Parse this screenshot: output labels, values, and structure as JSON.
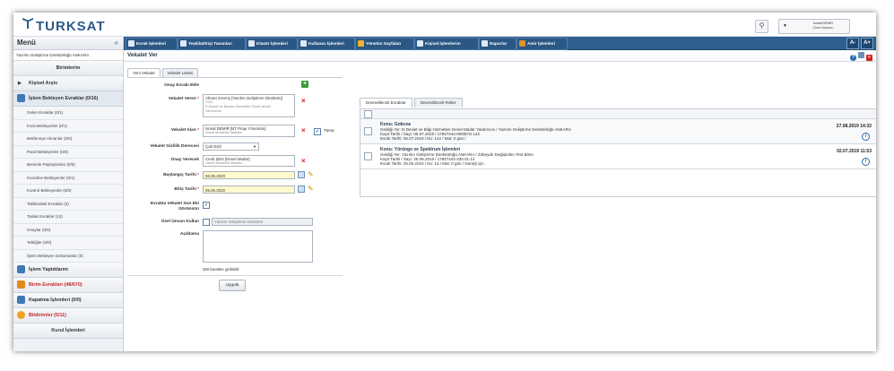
{
  "header": {
    "brand": "TURKSAT",
    "user_name": "İsmail DEMİR",
    "user_title": "(Daire Başkanı)"
  },
  "sidebar": {
    "title": "Menü",
    "unit": "Yazılım Geliştirme Direktörlüğü ANKARA",
    "sections": {
      "birimlerim": "Birimlerim",
      "kisisel_arsiv": "Kişisel Arşiv",
      "islem_bekleyen": "İşlem Bekleyen Evraklar (0/16)",
      "islem_yaptiklarim": "İşlem Yaptıklarım",
      "birim_evraklari": "Birim Evrakları (48/670)",
      "kapatma": "Kapatma İşlemleri (0/0)",
      "bildirimler": "Bildirimler (5/11)",
      "kurul": "Kurul İşlemleri"
    },
    "items": [
      "Gelen Evraklar (0/1)",
      "İmza Bekleyenler (0/1)",
      "Bekleneye Alınanlar (0/0)",
      "Paraf Bekleyenler (0/0)",
      "Benimle Paylaşılanlar (0/5)",
      "Koordine Bekleyenler (0/1)",
      "Kontrol Bekleyenler (0/0)",
      "Takibindeki Evraklar (0)",
      "Taslak Evraklar (13)",
      "Onaylar (0/0)",
      "Tebliğler (0/0)",
      "İşlem Bekleyen Dokümanlar (0)"
    ]
  },
  "toolbar": {
    "items": [
      "Evrak İşlemleri",
      "Teşkilat/Kişi Tanımları",
      "Klasör İşlemleri",
      "Kullanıcı İşlemleri",
      "Yönetim Sayfaları",
      "Kişisel İşlemlerim",
      "Raporlar",
      "Amir İşlemleri"
    ],
    "font_small": "A-",
    "font_large": "A+"
  },
  "page": {
    "title": "Vekalet Ver",
    "tabs": [
      "Yeni Vekalet",
      "Vekalet Listesi"
    ]
  },
  "form": {
    "onay_evraki_label": "Onay Evrakı Ekle",
    "vekalet_veren_label": "Vekalet Veren",
    "vekalet_veren_name": "Ahmet SAVAŞ [Yazılım Geliştirme Direktörü]",
    "vekalet_veren_l2": "YGD",
    "vekalet_veren_l3": "E-Devlet ve Birişim Hizmetleri Genel Müdür",
    "vekalet_veren_l4": "Yardımcısı",
    "vekalet_alan_label": "Vekalet Alan",
    "vekalet_alan_name": "İsmail DEMİR [BT Proje Yöneticisi]",
    "vekalet_alan_sub": "Genel Müdürlük Makamı",
    "tumu_label": "Tümü",
    "gizlilik_label": "Vekalet Gizlilik Derecesi",
    "gizlilik_value": "Çok Gizli",
    "onay_verecek_label": "Onay Verecek",
    "onay_verecek_name": "Cenk ŞEN [Genel Müdür]",
    "onay_verecek_sub": "Genel Müdürlük Makamı",
    "baslangic_label": "Başlangıç Tarihi",
    "baslangic_value": "06.05.2020",
    "bitis_label": "Bitiş Tarihi",
    "bitis_value": "06.05.2020",
    "son_eki_label_1": "Evrakta Vekalet Son Eki",
    "son_eki_label_2": "Görünsün",
    "ozel_unvan_label": "Özel Ünvan Kullan",
    "ozel_unvan_placeholder": "Yazılım Geliştirme Direktörü",
    "aciklama_label": "Açıklama",
    "char_count": "250 karakter girilebilir",
    "submit": "Uygula"
  },
  "right": {
    "tabs": [
      "Devredilecek Evraklar",
      "Devredilecek Roller"
    ],
    "items": [
      {
        "subject": "Konu: Gokcea",
        "line1": "Geldiği Yer: E-Devlet ve Bilgi Hizmetleri Genel Müdür Yardımcısı / Yazılım Geliştirme Direktörlüğü ANKARA",
        "line2": "Kayıt Tarihi / Sayı: 05.07.2019 / 17827444-00000-E.142",
        "line3": "Evrak Tarihi: 05.07.2019 / No: 142 / Mat: 0 gün /",
        "date": "27.08.2019 14:32"
      },
      {
        "subject": "Konu: Yörünge ve Spektrum İşlemleri",
        "line1": "Geldiği Yer: Yazılım Geliştirme Direktörlüğü ANKARA / Zübeyde Değiştirilen Test Birim",
        "line2": "Kayıt Tarihi / Sayı: 25.06.2019 / 17827444-230.01-14",
        "line3": "Evrak Tarihi: 25.06.2019 / No: 14 / Mat: 0 gün / Gereği için",
        "date": "02.07.2019 11:53"
      }
    ]
  }
}
